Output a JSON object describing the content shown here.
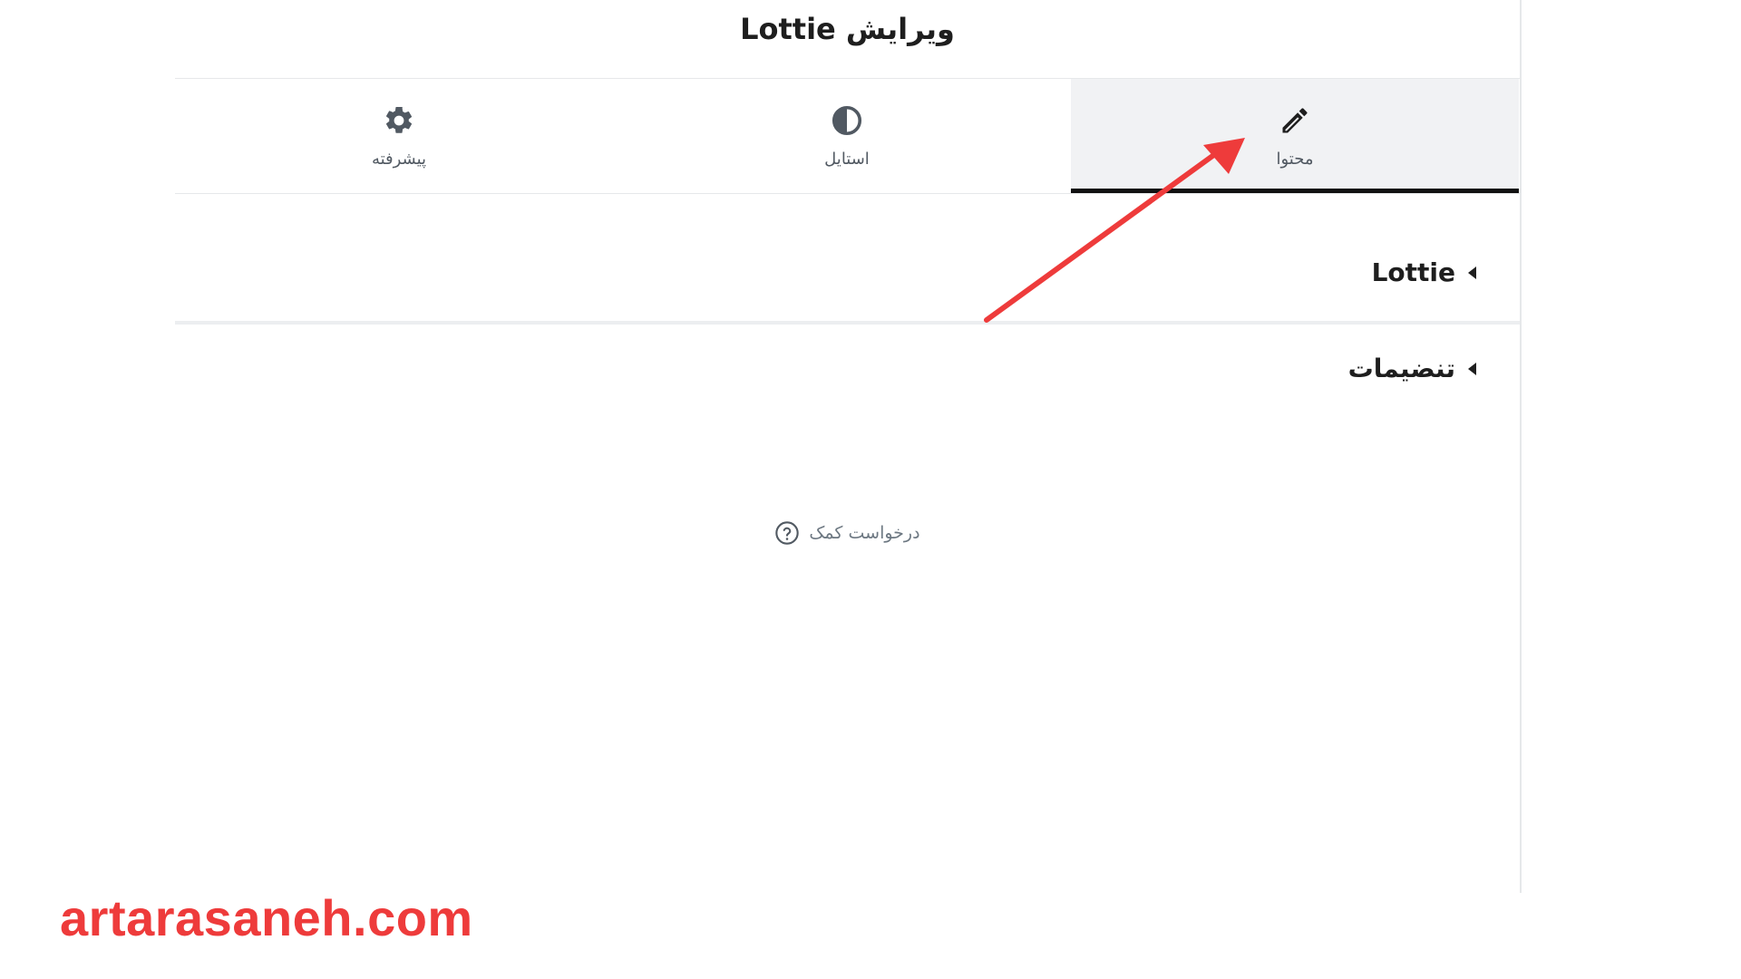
{
  "panel": {
    "title": "ویرایش Lottie"
  },
  "tabs": [
    {
      "label": "پیشرفته",
      "icon": "gear-icon",
      "active": false
    },
    {
      "label": "استایل",
      "icon": "contrast-icon",
      "active": false
    },
    {
      "label": "محتوا",
      "icon": "pencil-icon",
      "active": true
    }
  ],
  "sections": {
    "lottie": {
      "title": "Lottie",
      "icon": "caret-left-icon"
    },
    "settings": {
      "title": "تنضیمات",
      "icon": "caret-left-icon"
    }
  },
  "help": {
    "label": "درخواست کمک",
    "icon": "question-circle-icon"
  },
  "watermark": {
    "text": "artarasaneh.com"
  },
  "colors": {
    "accent_arrow": "#ee3b3b",
    "active_tab_bg": "#f1f2f4",
    "active_tab_border": "#111111",
    "text_dark": "#1e1e1e",
    "text_muted": "#515962"
  }
}
